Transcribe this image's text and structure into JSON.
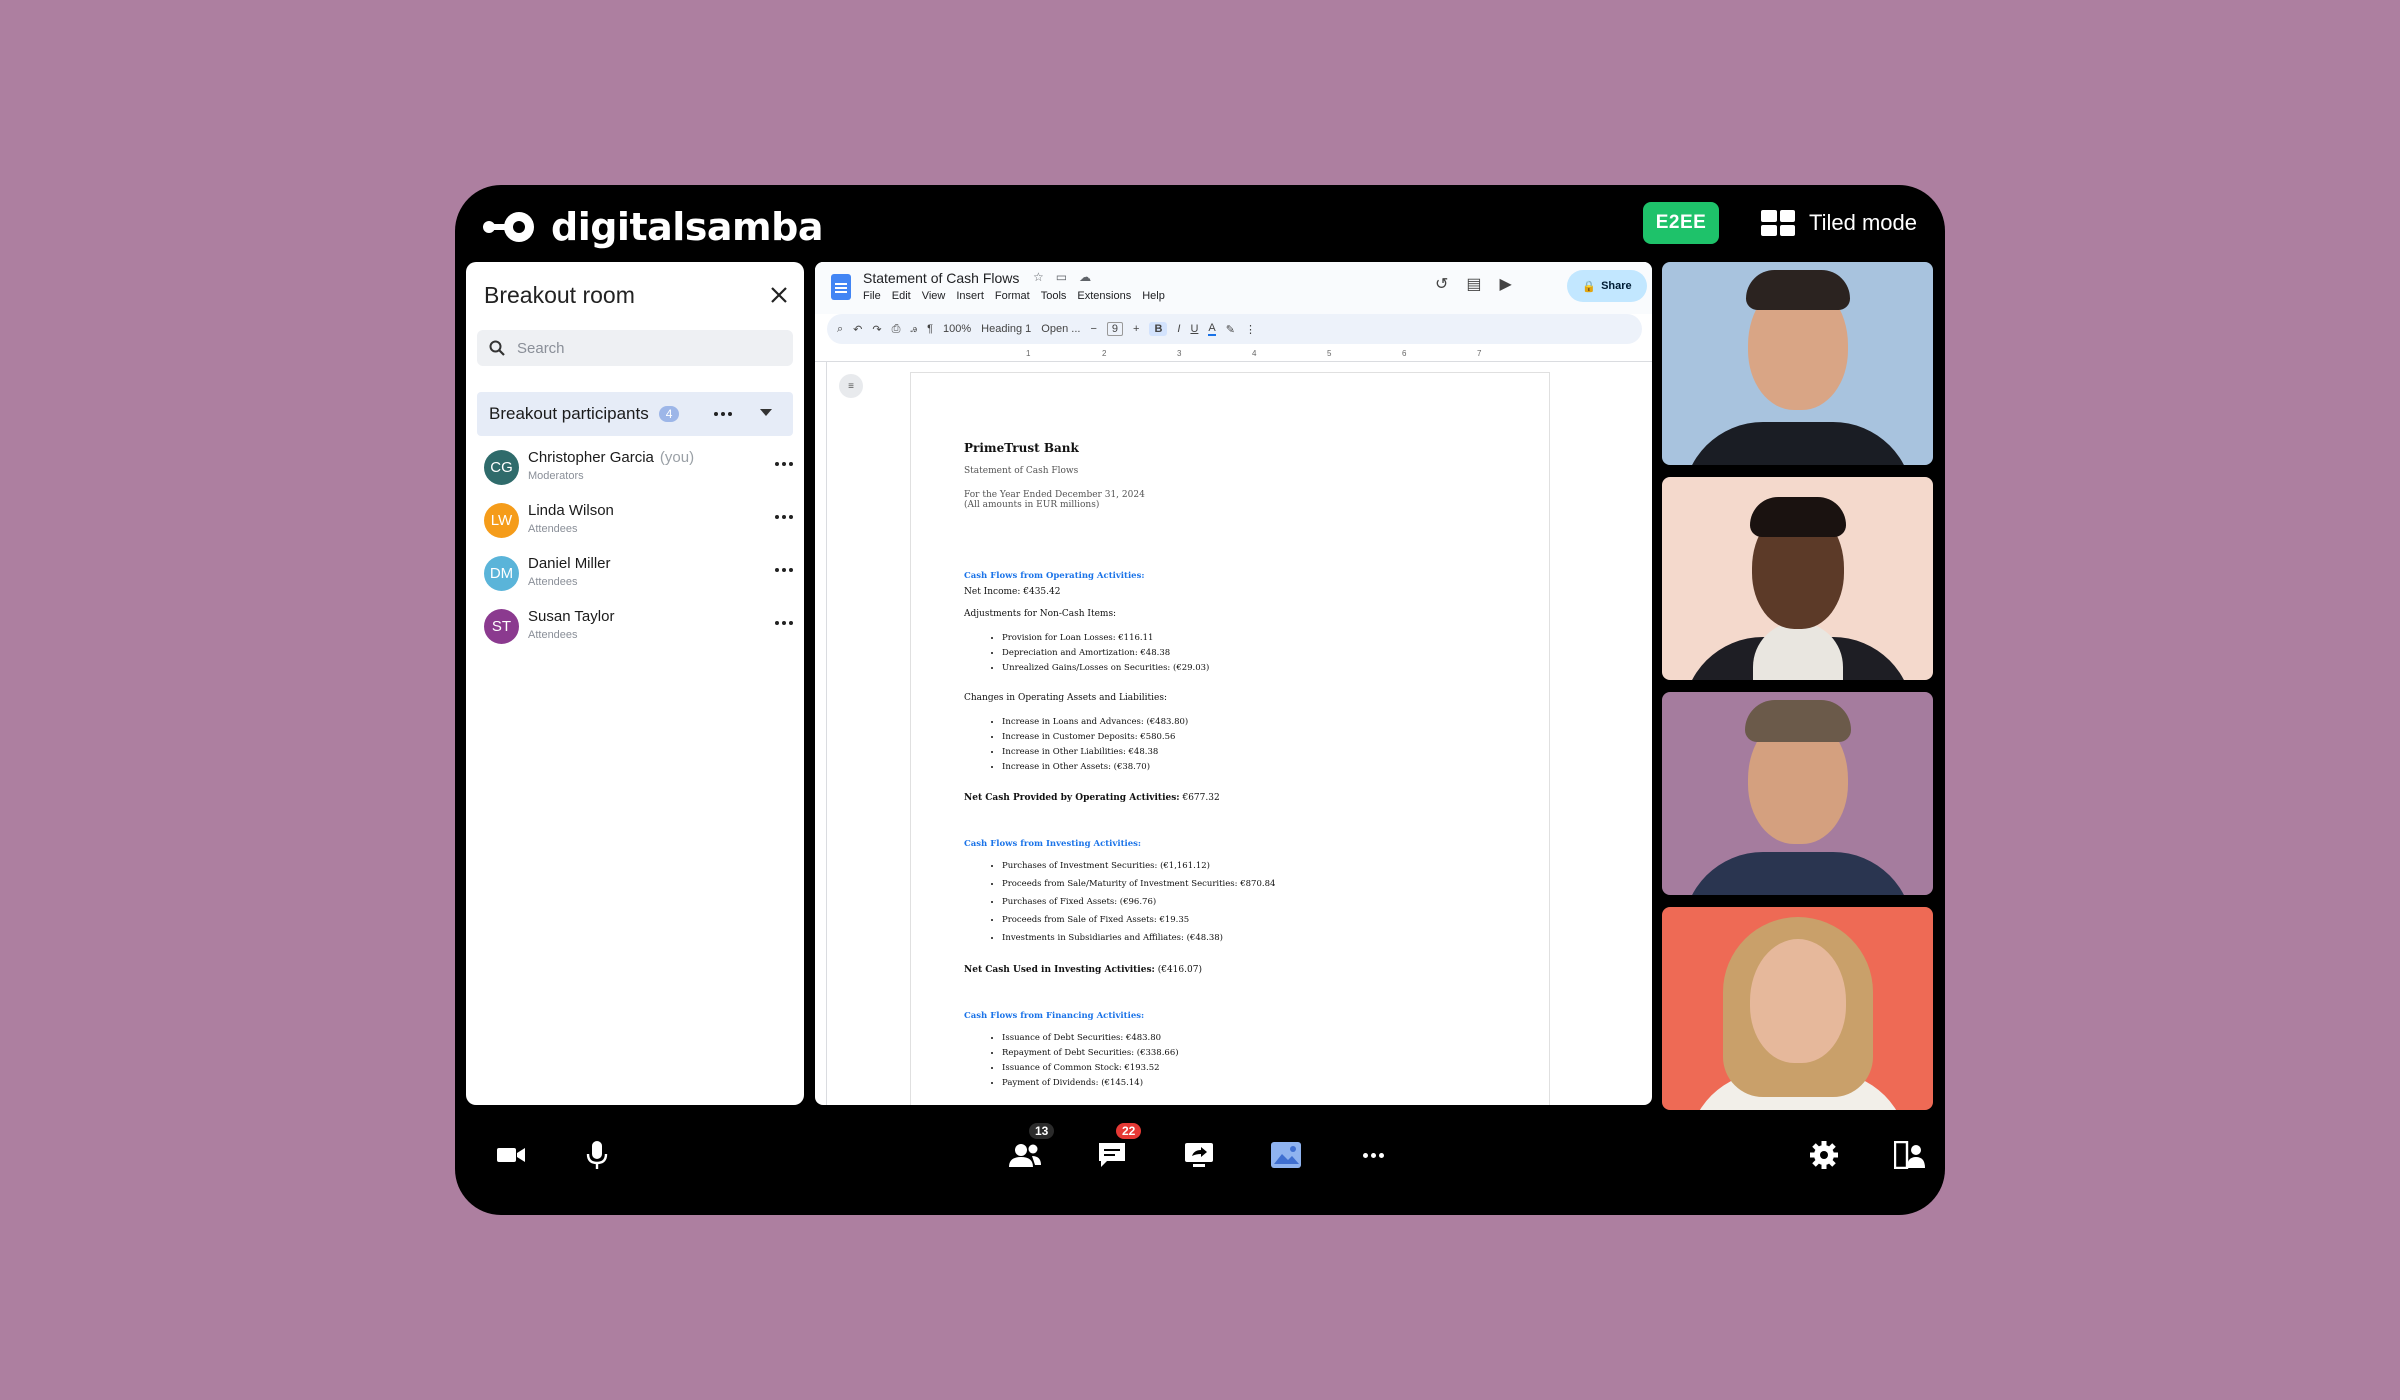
{
  "app": {
    "logo_text": "digitalsamba",
    "e2ee_label": "E2EE",
    "tiled_mode_label": "Tiled mode"
  },
  "sidebar": {
    "title": "Breakout room",
    "search_placeholder": "Search",
    "section_label": "Breakout participants",
    "section_count": "4",
    "participants": [
      {
        "initials": "CG",
        "name": "Christopher Garcia",
        "you": "(you)",
        "role": "Moderators",
        "color": "#2f6b6b"
      },
      {
        "initials": "LW",
        "name": "Linda Wilson",
        "you": "",
        "role": "Attendees",
        "color": "#f59c1a"
      },
      {
        "initials": "DM",
        "name": "Daniel Miller",
        "you": "",
        "role": "Attendees",
        "color": "#5ab4d9"
      },
      {
        "initials": "ST",
        "name": "Susan Taylor",
        "you": "",
        "role": "Attendees",
        "color": "#8b3a8f"
      }
    ]
  },
  "document": {
    "title": "Statement of Cash Flows",
    "menu": [
      "File",
      "Edit",
      "View",
      "Insert",
      "Format",
      "Tools",
      "Extensions",
      "Help"
    ],
    "share_label": "Share",
    "toolbar": {
      "zoom": "100%",
      "style": "Heading 1",
      "font": "Open ...",
      "size": "9"
    },
    "ruler": [
      "1",
      "2",
      "3",
      "4",
      "5",
      "6",
      "7"
    ],
    "bank": "PrimeTrust Bank",
    "subtitle": "Statement of Cash Flows",
    "period_1": "For the Year Ended December 31, 2024",
    "period_2": "(All amounts in EUR millions)",
    "op_heading": "Cash Flows from Operating Activities:",
    "net_income": "Net Income: €435.42",
    "adj_heading": "Adjustments for Non-Cash Items:",
    "adj_items": [
      "Provision for Loan Losses: €116.11",
      "Depreciation and Amortization: €48.38",
      "Unrealized Gains/Losses on Securities: (€29.03)"
    ],
    "chg_heading": "Changes in Operating Assets and Liabilities:",
    "chg_items": [
      "Increase in Loans and Advances: (€483.80)",
      "Increase in Customer Deposits: €580.56",
      "Increase in Other Liabilities: €48.38",
      "Increase in Other Assets: (€38.70)"
    ],
    "op_total_label": "Net Cash Provided by Operating Activities:",
    "op_total_value": " €677.32",
    "inv_heading": "Cash Flows from Investing Activities:",
    "inv_items": [
      "Purchases of Investment Securities: (€1,161.12)",
      "Proceeds from Sale/Maturity of Investment Securities: €870.84",
      "Purchases of Fixed Assets: (€96.76)",
      "Proceeds from Sale of Fixed Assets: €19.35",
      "Investments in Subsidiaries and Affiliates: (€48.38)"
    ],
    "inv_total_label": "Net Cash Used in Investing Activities:",
    "inv_total_value": " (€416.07)",
    "fin_heading": "Cash Flows from Financing Activities:",
    "fin_items": [
      "Issuance of Debt Securities: €483.80",
      "Repayment of Debt Securities: (€338.66)",
      "Issuance of Common Stock: €193.52",
      "Payment of Dividends: (€145.14)"
    ]
  },
  "video_tiles": [
    {
      "bg": "#a8c3de",
      "skin": "#d9a585",
      "hair": "#2b2320",
      "shirt": "#1a1d24"
    },
    {
      "bg": "#f4d9cc",
      "skin": "#5c3a28",
      "hair": "#1a1210",
      "shirt": "#e9e6e0"
    },
    {
      "bg": "#a57c9e",
      "skin": "#d4a07f",
      "hair": "#6b5a4a",
      "shirt": "#2a3550"
    },
    {
      "bg": "#ee6a55",
      "skin": "#e6b89b",
      "hair": "#c9a06a",
      "shirt": "#f2efe9"
    }
  ],
  "controls": {
    "participants_count": "13",
    "chat_count": "22",
    "participants_badge_color": "#2b2b2b",
    "chat_badge_color": "#e53935"
  }
}
